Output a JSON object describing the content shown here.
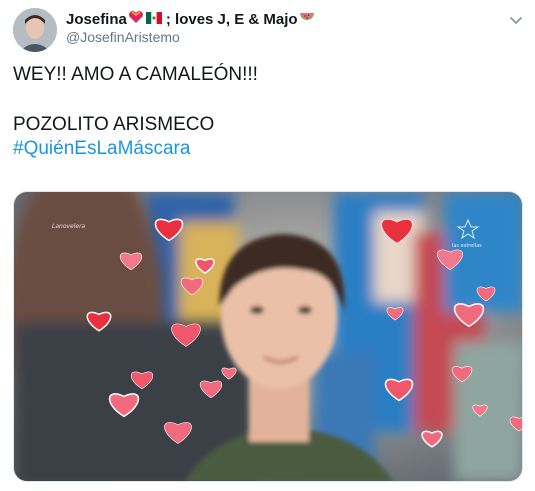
{
  "tweet": {
    "display_name": "Josefina",
    "display_name_suffix": "; loves J, E & Majo",
    "handle": "@JosefinAristemo",
    "lines": {
      "line1": "WEY!! AMO A CAMALEÓN!!!",
      "line2": "POZOLITO ARISMECO",
      "hashtag": "#QuiénEsLaMáscara"
    },
    "icons": {
      "name_emojis": [
        "heart-with-ribbon-emoji",
        "mexico-flag-emoji"
      ],
      "name_trailing_emoji": "watermelon-emoji",
      "menu": "chevron-down-icon"
    }
  },
  "media": {
    "watermarks": {
      "left": "Lanovelera",
      "right": "las estrellas"
    }
  },
  "colors": {
    "hashtag": "#1b95e0",
    "handle": "#657786",
    "heart": "#e8435a",
    "heart_pink": "#f26a7d"
  }
}
